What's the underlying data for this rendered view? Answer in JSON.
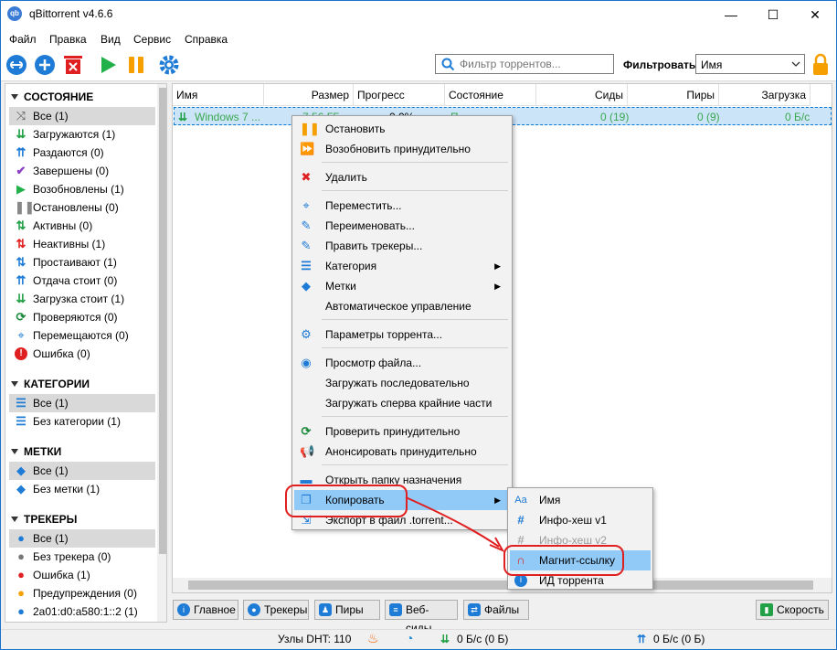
{
  "window": {
    "title": "qBittorrent v4.6.6",
    "icon_text": "qb",
    "min_glyph": "—",
    "max_glyph": "☐",
    "close_glyph": "✕"
  },
  "menu": [
    "Файл",
    "Правка",
    "Вид",
    "Сервис",
    "Справка"
  ],
  "toolbar": {
    "filter_placeholder": "Фильтр торрентов...",
    "filter_label": "Фильтровать:",
    "filter_select": "Имя"
  },
  "sidebar": {
    "status_header": "СОСТОЯНИЕ",
    "status_items": [
      "Все (1)",
      "Загружаются (1)",
      "Раздаются (0)",
      "Завершены (0)",
      "Возобновлены (1)",
      "Остановлены (0)",
      "Активны (0)",
      "Неактивны (1)",
      "Простаивают (1)",
      "Отдача стоит (0)",
      "Загрузка стоит (1)",
      "Проверяются (0)",
      "Перемещаются (0)",
      "Ошибка (0)"
    ],
    "category_header": "КАТЕГОРИИ",
    "category_items": [
      "Все (1)",
      "Без категории (1)"
    ],
    "tag_header": "МЕТКИ",
    "tag_items": [
      "Все (1)",
      "Без метки (1)"
    ],
    "tracker_header": "ТРЕКЕРЫ",
    "tracker_items": [
      "Все (1)",
      "Без трекера (0)",
      "Ошибка (1)",
      "Предупреждения (0)",
      "2a01:d0:a580:1::2 (1)"
    ]
  },
  "table": {
    "columns": [
      "Имя",
      "Размер",
      "Прогресс",
      "Состояние",
      "Сиды",
      "Пиры",
      "Загрузка"
    ],
    "row": {
      "name": "Windows 7 ...",
      "size": "7,56 ГБ",
      "progress": "0,0%",
      "state": "П",
      "seeds": "0 (19)",
      "peers": "0 (9)",
      "download": "0 Б/с"
    }
  },
  "context_menu": [
    "Остановить",
    "Возобновить принудительно",
    "Удалить",
    "Переместить...",
    "Переименовать...",
    "Править трекеры...",
    "Категория",
    "Метки",
    "Автоматическое управление",
    "Параметры торрента...",
    "Просмотр файла...",
    "Загружать последовательно",
    "Загружать сперва крайние части",
    "Проверить принудительно",
    "Анонсировать принудительно",
    "Открыть папку назначения",
    "Копировать",
    "Экспорт в файл .torrent..."
  ],
  "copy_submenu": [
    "Имя",
    "Инфо-хеш v1",
    "Инфо-хеш v2",
    "Магнит-ссылку",
    "ИД торрента"
  ],
  "bottom_tabs": [
    "Главное",
    "Трекеры",
    "Пиры",
    "Веб-сиды",
    "Файлы"
  ],
  "speed_button": "Скорость",
  "status": {
    "dht": "Узлы DHT: 110",
    "down": "0 Б/с (0 Б)",
    "up": "0 Б/с (0 Б)"
  },
  "colors": {
    "accent": "#1e7bd6",
    "highlight": "#91c9f7",
    "annotation": "#e02020",
    "green": "#3aa850",
    "orange": "#f5a000"
  }
}
